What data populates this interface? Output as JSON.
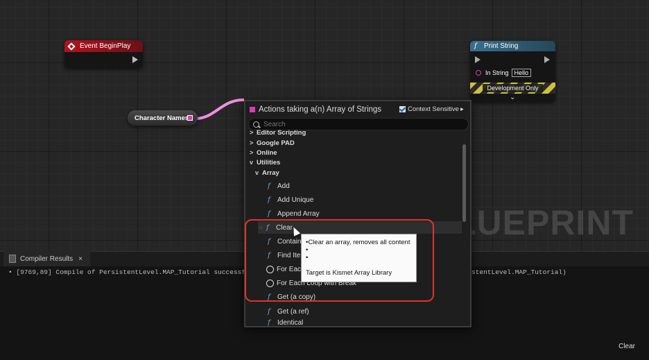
{
  "graph": {
    "watermark": "BLUEPRINT",
    "event_node": {
      "title": "Event BeginPlay",
      "color": "#b3121e"
    },
    "var_node": {
      "label": "Character Names"
    },
    "print_node": {
      "title": "Print String",
      "in_string_label": "In String",
      "in_string_value": "Hello",
      "dev_label": "Development Only"
    }
  },
  "menu": {
    "title": "Actions taking a(n) Array of Strings",
    "context_sensitive": "Context Sensitive",
    "search_placeholder": "Search",
    "items": [
      {
        "label": "Editor Scripting",
        "kind": "category",
        "arrow": ">"
      },
      {
        "label": "Google PAD",
        "kind": "category",
        "arrow": ">"
      },
      {
        "label": "Online",
        "kind": "category",
        "arrow": ">"
      },
      {
        "label": "Utilities",
        "kind": "category",
        "arrow": "v"
      },
      {
        "label": "Array",
        "kind": "subcategory",
        "arrow": "v"
      },
      {
        "label": "Add",
        "kind": "function"
      },
      {
        "label": "Add Unique",
        "kind": "function"
      },
      {
        "label": "Append Array",
        "kind": "function"
      },
      {
        "label": "Clear",
        "kind": "function"
      },
      {
        "label": "Contain",
        "kind": "function"
      },
      {
        "label": "Find Ite",
        "kind": "function"
      },
      {
        "label": "For Each",
        "kind": "macro"
      },
      {
        "label": "For Each Loop with Break",
        "kind": "macro"
      },
      {
        "label": "Get (a copy)",
        "kind": "function"
      },
      {
        "label": "Get (a ref)",
        "kind": "function"
      },
      {
        "label": "Identical",
        "kind": "function"
      }
    ]
  },
  "tooltip": {
    "line1": "•Clear an array, removes all content",
    "line2": "•",
    "line3": "•",
    "line4": "Target is Kismet Array Library"
  },
  "bottom_panel": {
    "tab_label": "Compiler Results",
    "tab_close": "×",
    "log_left": "•  [9769,89] Compile of PersistentLevel.MAP_Tutorial successf",
    "log_right": "stentLevel.MAP_Tutorial)",
    "clear_label": "Clear"
  }
}
